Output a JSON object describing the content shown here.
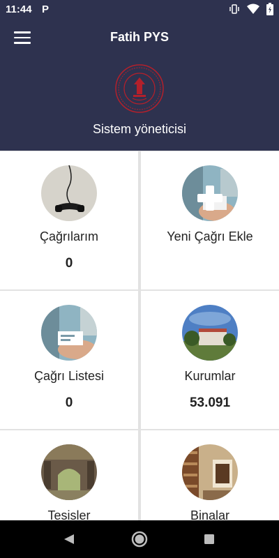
{
  "status_bar": {
    "time": "11:44",
    "notification": "P"
  },
  "app_bar": {
    "title": "Fatih PYS",
    "role": "Sistem yöneticisi",
    "background": "#2e324f",
    "logo_color": "#b3202b"
  },
  "cards": [
    {
      "label": "Çağrılarım",
      "count": "0",
      "image": "telephone-handset"
    },
    {
      "label": "Yeni Çağrı Ekle",
      "count": "",
      "image": "add-call-hand"
    },
    {
      "label": "Çağrı Listesi",
      "count": "0",
      "image": "card-in-hand"
    },
    {
      "label": "Kurumlar",
      "count": "53.091",
      "image": "campus-building"
    },
    {
      "label": "Tesisler",
      "count": "",
      "image": "archway-courtyard"
    },
    {
      "label": "Binalar",
      "count": "",
      "image": "library-shelves"
    }
  ],
  "nav": {
    "back": "back-icon",
    "home": "home-icon",
    "recents": "recents-icon"
  }
}
